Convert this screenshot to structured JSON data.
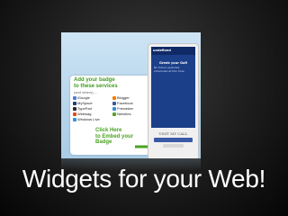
{
  "slide": {
    "caption": "Widgets for your Web!"
  },
  "badge_panel": {
    "heading": "Add your badge\nto these services",
    "subheading": "(and others)....",
    "services": [
      {
        "label": "iGoogle",
        "icon": "igoogle-icon",
        "color": "#4a7fd8"
      },
      {
        "label": "Blogger",
        "icon": "blogger-icon",
        "color": "#f57d00"
      },
      {
        "label": "MySpace",
        "icon": "myspace-icon",
        "color": "#1d3b75"
      },
      {
        "label": "Facebook",
        "icon": "facebook-icon",
        "color": "#3b5998"
      },
      {
        "label": "TypePad",
        "icon": "typepad-icon",
        "color": "#2b2b2b"
      },
      {
        "label": "Friendster",
        "icon": "friendster-icon",
        "color": "#3a8ad6"
      },
      {
        "label": "Webwag",
        "icon": "webwag-icon",
        "color": "#e04b1a"
      },
      {
        "label": "Netvibes",
        "icon": "netvibes-icon",
        "color": "#5aa02c"
      },
      {
        "label": "Windows Live",
        "icon": "windows-live-icon",
        "color": "#3a8fd6"
      }
    ],
    "call_to_action": "Click Here\nto Embed your\nBadge",
    "accent_color": "#4aa322"
  },
  "phone_widget": {
    "header": "undefined",
    "title": "Greeb your Gofl",
    "text": "No future episodes\nscheduled at this time.",
    "visit_label": "VISIT MY CALL"
  }
}
